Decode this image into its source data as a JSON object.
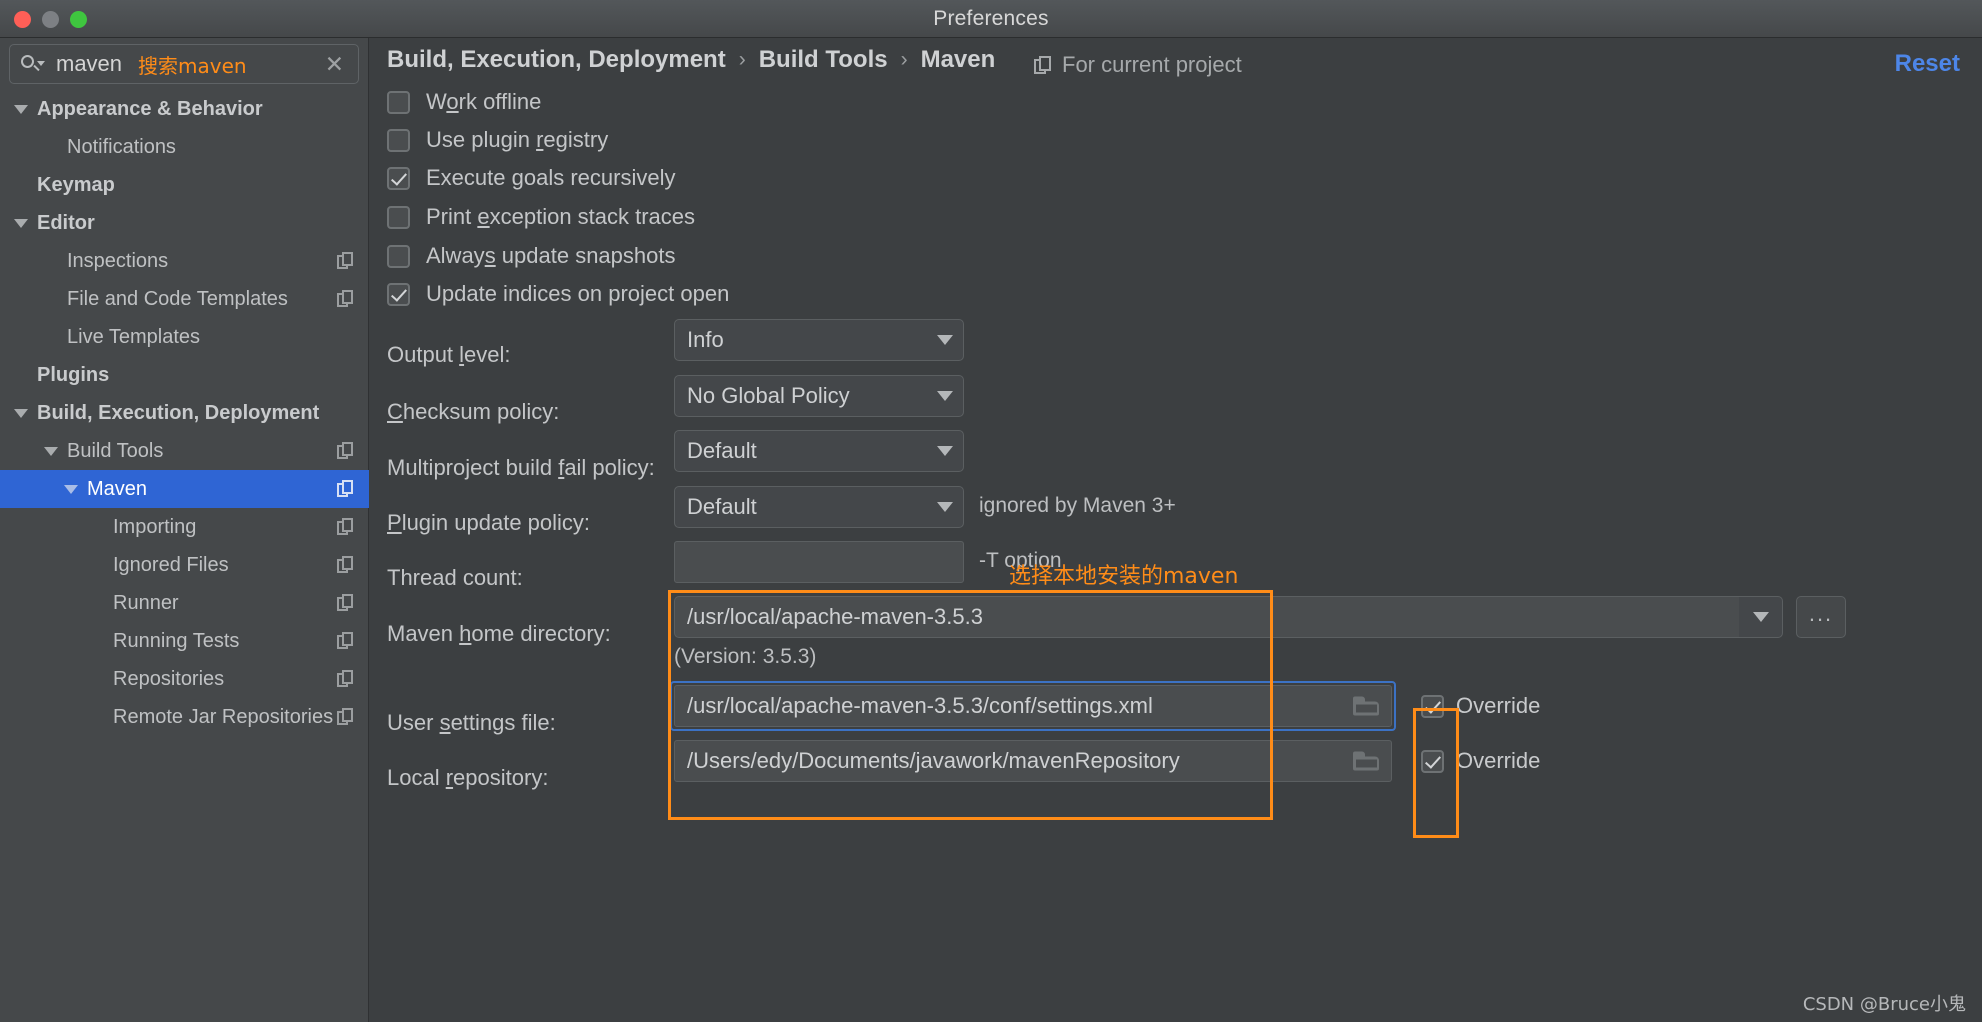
{
  "window": {
    "title": "Preferences",
    "traffic_lights": [
      "close",
      "minimize",
      "zoom"
    ]
  },
  "search": {
    "value": "maven",
    "annotation": "搜索maven",
    "clear_label": "✕"
  },
  "sidebar": {
    "items": [
      {
        "label": "Appearance & Behavior",
        "indent": 0,
        "arrow": "down",
        "bold": true,
        "copy": false,
        "selected": false
      },
      {
        "label": "Notifications",
        "indent": 1,
        "arrow": "none",
        "bold": false,
        "copy": false,
        "selected": false
      },
      {
        "label": "Keymap",
        "indent": 0,
        "arrow": "none",
        "bold": true,
        "copy": false,
        "selected": false
      },
      {
        "label": "Editor",
        "indent": 0,
        "arrow": "down",
        "bold": true,
        "copy": false,
        "selected": false
      },
      {
        "label": "Inspections",
        "indent": 1,
        "arrow": "none",
        "bold": false,
        "copy": true,
        "selected": false
      },
      {
        "label": "File and Code Templates",
        "indent": 1,
        "arrow": "none",
        "bold": false,
        "copy": true,
        "selected": false
      },
      {
        "label": "Live Templates",
        "indent": 1,
        "arrow": "none",
        "bold": false,
        "copy": false,
        "selected": false
      },
      {
        "label": "Plugins",
        "indent": 0,
        "arrow": "none",
        "bold": true,
        "copy": false,
        "selected": false
      },
      {
        "label": "Build, Execution, Deployment",
        "indent": 0,
        "arrow": "down",
        "bold": true,
        "copy": false,
        "selected": false
      },
      {
        "label": "Build Tools",
        "indent": 1,
        "arrow": "down",
        "bold": false,
        "copy": true,
        "selected": false
      },
      {
        "label": "Maven",
        "indent": 2,
        "arrow": "down",
        "bold": false,
        "copy": true,
        "selected": true
      },
      {
        "label": "Importing",
        "indent": 3,
        "arrow": "none",
        "bold": false,
        "copy": true,
        "selected": false
      },
      {
        "label": "Ignored Files",
        "indent": 3,
        "arrow": "none",
        "bold": false,
        "copy": true,
        "selected": false
      },
      {
        "label": "Runner",
        "indent": 3,
        "arrow": "none",
        "bold": false,
        "copy": true,
        "selected": false
      },
      {
        "label": "Running Tests",
        "indent": 3,
        "arrow": "none",
        "bold": false,
        "copy": true,
        "selected": false
      },
      {
        "label": "Repositories",
        "indent": 3,
        "arrow": "none",
        "bold": false,
        "copy": true,
        "selected": false
      },
      {
        "label": "Remote Jar Repositories",
        "indent": 3,
        "arrow": "none",
        "bold": false,
        "copy": true,
        "selected": false
      }
    ]
  },
  "header": {
    "breadcrumb": [
      "Build, Execution, Deployment",
      "Build Tools",
      "Maven"
    ],
    "separator": "›",
    "for_current_project": "For current project",
    "reset": "Reset"
  },
  "checkboxes": [
    {
      "label": "Work offline",
      "mnemonic": "o",
      "checked": false
    },
    {
      "label": "Use plugin registry",
      "mnemonic": "r",
      "checked": false
    },
    {
      "label": "Execute goals recursively",
      "mnemonic": "g",
      "checked": true
    },
    {
      "label": "Print exception stack traces",
      "mnemonic": "e",
      "checked": false
    },
    {
      "label": "Always update snapshots",
      "mnemonic": "s",
      "checked": false
    },
    {
      "label": "Update indices on project open",
      "mnemonic": "",
      "checked": true
    }
  ],
  "fields": {
    "output_level": {
      "label": "Output level:",
      "mnemonic": "l",
      "value": "Info"
    },
    "checksum": {
      "label": "Checksum policy:",
      "mnemonic": "C",
      "value": "No Global Policy"
    },
    "multiproject": {
      "label": "Multiproject build fail policy:",
      "mnemonic": "f",
      "value": "Default"
    },
    "plugin_update": {
      "label": "Plugin update policy:",
      "mnemonic": "P",
      "value": "Default",
      "hint": "ignored by Maven 3+"
    },
    "thread_count": {
      "label": "Thread count:",
      "mnemonic": "",
      "value": "",
      "hint": "-T option",
      "annotation": "选择本地安装的maven"
    },
    "maven_home": {
      "label": "Maven home directory:",
      "mnemonic": "h",
      "value": "/usr/local/apache-maven-3.5.3",
      "version": "(Version: 3.5.3)",
      "browse": "..."
    },
    "user_settings": {
      "label": "User settings file:",
      "mnemonic": "s",
      "value": "/usr/local/apache-maven-3.5.3/conf/settings.xml",
      "override": "Override",
      "override_checked": true
    },
    "local_repo": {
      "label": "Local repository:",
      "mnemonic": "r",
      "value": "/Users/edy/Documents/javawork/mavenRepository",
      "override": "Override",
      "override_checked": true
    }
  },
  "watermark": "CSDN @Bruce小鬼",
  "colors": {
    "accent_blue": "#2f65d4",
    "annotation_orange": "#ff8c18",
    "reset_link": "#4d86e8",
    "panel_bg": "#3c3f41",
    "sidebar_bg": "#45484a",
    "focus_ring": "#3c72c4"
  }
}
